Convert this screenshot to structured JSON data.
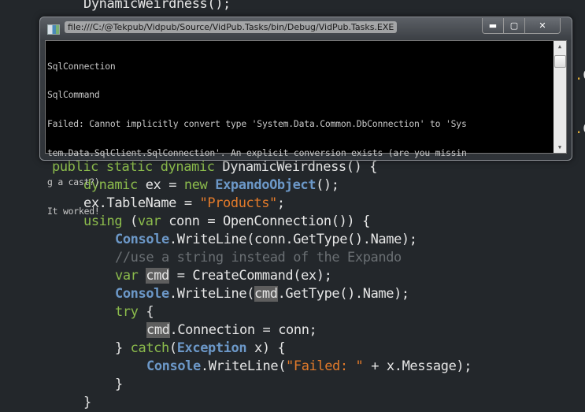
{
  "console_window": {
    "title": "file:///C:/@Tekpub/Vidpub/Source/VidPub.Tasks/bin/Debug/VidPub.Tasks.EXE",
    "buttons": {
      "minimize": "▬",
      "maximize": "▢",
      "close": "✕"
    },
    "icon": "console-app-icon",
    "output_lines": [
      "SqlConnection",
      "SqlCommand",
      "Failed: Cannot implicitly convert type 'System.Data.Common.DbConnection' to 'Sys",
      "tem.Data.SqlClient.SqlConnection'. An explicit conversion exists (are you missin",
      "g a cast?)",
      "It worked!"
    ],
    "scrollbar": {
      "up": "▲",
      "down": "▼"
    }
  },
  "editor": {
    "top_line": "DynamicWeirdness();",
    "side_fragment": "C",
    "code": {
      "l1": [
        "public",
        " ",
        "static",
        " ",
        "dynamic",
        " DynamicWeirdness() {"
      ],
      "l2": [
        "dynamic",
        " ex = ",
        "new",
        " ",
        "ExpandoObject",
        "();"
      ],
      "l3": [
        "ex.TableName = ",
        "\"Products\"",
        ";"
      ],
      "l4": [
        "using",
        " (",
        "var",
        " conn = OpenConnection()) {"
      ],
      "l5": [
        "Console",
        ".WriteLine(conn.GetType().Name);"
      ],
      "l6": [
        "//use a string instead of the Expando"
      ],
      "l7": [
        "var",
        " ",
        "cmd",
        " = CreateCommand(ex);"
      ],
      "l8": [
        "Console",
        ".WriteLine(",
        "cmd",
        ".GetType().Name);"
      ],
      "l9": [
        "try",
        " {"
      ],
      "l10": [
        "cmd",
        ".Connection = conn;"
      ],
      "l11": [
        "} ",
        "catch",
        "(",
        "Exception",
        " x) {"
      ],
      "l12": [
        "Console",
        ".WriteLine(",
        "\"Failed: \"",
        " + x.Message);"
      ],
      "l13": [
        "}"
      ],
      "l14": [
        "}"
      ]
    }
  }
}
